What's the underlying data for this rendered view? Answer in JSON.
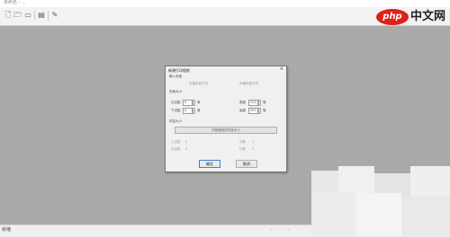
{
  "app": {
    "title": "未命名 - ..."
  },
  "toolbar": {
    "icons": [
      "new-file-icon",
      "open-folder-icon",
      "folder-icon",
      "print-icon",
      "edit-icon"
    ]
  },
  "logo": {
    "badge": "php",
    "text": "中文网"
  },
  "status": {
    "text": "就绪",
    "extra1": "-",
    "extra2": "-"
  },
  "dialog": {
    "title": "新建打印相纸",
    "close": "×",
    "section_layout": "输入页面",
    "radio_portrait": "纵横页面方向",
    "radio_landscape": "纵横页面方向",
    "section_page_size": "页面大小",
    "left_margin_label": "左边距",
    "left_margin_value": "0",
    "left_margin_unit": "毫",
    "width_label": "宽度",
    "width_value": "210",
    "width_unit": "毫",
    "bottom_margin_label": "下边距",
    "bottom_margin_value": "0",
    "bottom_margin_unit": "毫",
    "height_label": "高度",
    "height_value": "297",
    "height_unit": "毫",
    "section_content_size": "内容大小",
    "fit_button": "内容使用的内容大小",
    "disabled": {
      "r1_left_label": "上边距",
      "r1_left_value": "0",
      "r1_right_label": "列数",
      "r1_right_value": "1",
      "r2_left_label": "右边距",
      "r2_left_value": "0",
      "r2_right_label": "行数",
      "r2_right_value": "1"
    },
    "ok_button": "确定",
    "cancel_button": "取消"
  }
}
